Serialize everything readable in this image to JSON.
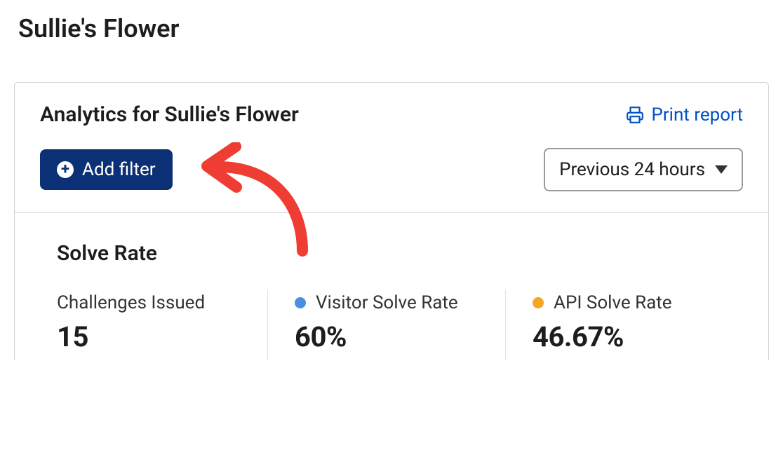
{
  "page": {
    "title": "Sullie's Flower"
  },
  "panel": {
    "title": "Analytics for Sullie's Flower",
    "print_label": "Print report"
  },
  "filters": {
    "add_filter_label": "Add filter",
    "time_range_label": "Previous 24 hours"
  },
  "solve_rate": {
    "section_title": "Solve Rate",
    "metrics": [
      {
        "label": "Challenges Issued",
        "value": "15",
        "dot_color": null
      },
      {
        "label": "Visitor Solve Rate",
        "value": "60%",
        "dot_color": "#4a90e2"
      },
      {
        "label": "API Solve Rate",
        "value": "46.67%",
        "dot_color": "#f5a623"
      }
    ]
  }
}
